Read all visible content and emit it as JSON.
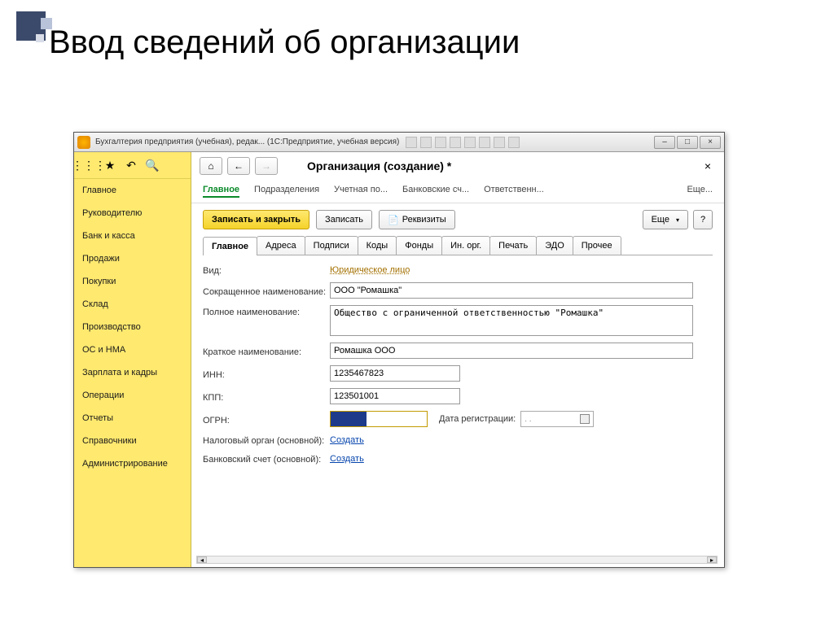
{
  "slide_heading": "Ввод сведений об организации",
  "window_title": "Бухгалтерия предприятия (учебная), редак... (1С:Предприятие, учебная версия)",
  "sidebar": {
    "items": [
      "Главное",
      "Руководителю",
      "Банк и касса",
      "Продажи",
      "Покупки",
      "Склад",
      "Производство",
      "ОС и НМА",
      "Зарплата и кадры",
      "Операции",
      "Отчеты",
      "Справочники",
      "Администрирование"
    ]
  },
  "page_title": "Организация (создание) *",
  "main_tabs": [
    "Главное",
    "Подразделения",
    "Учетная по...",
    "Банковские сч...",
    "Ответственн..."
  ],
  "main_tabs_more": "Еще...",
  "actions": {
    "save_close": "Записать и закрыть",
    "save": "Записать",
    "requisites": "Реквизиты",
    "more": "Еще",
    "help": "?"
  },
  "sub_tabs": [
    "Главное",
    "Адреса",
    "Подписи",
    "Коды",
    "Фонды",
    "Ин. орг.",
    "Печать",
    "ЭДО",
    "Прочее"
  ],
  "form": {
    "type_label": "Вид:",
    "type_value": "Юридическое лицо",
    "short_name_label": "Сокращенное наименование:",
    "short_name_value": "ООО \"Ромашка\"",
    "full_name_label": "Полное наименование:",
    "full_name_value": "Общество с ограниченной ответственностью \"Ромашка\"",
    "brief_name_label": "Краткое наименование:",
    "brief_name_value": "Ромашка ООО",
    "inn_label": "ИНН:",
    "inn_value": "1235467823",
    "kpp_label": "КПП:",
    "kpp_value": "123501001",
    "ogrn_label": "ОГРН:",
    "reg_date_label": "Дата регистрации:",
    "reg_date_value": " . .",
    "tax_label": "Налоговый орган (основной):",
    "bank_label": "Банковский счет (основной):",
    "create_link": "Создать"
  }
}
